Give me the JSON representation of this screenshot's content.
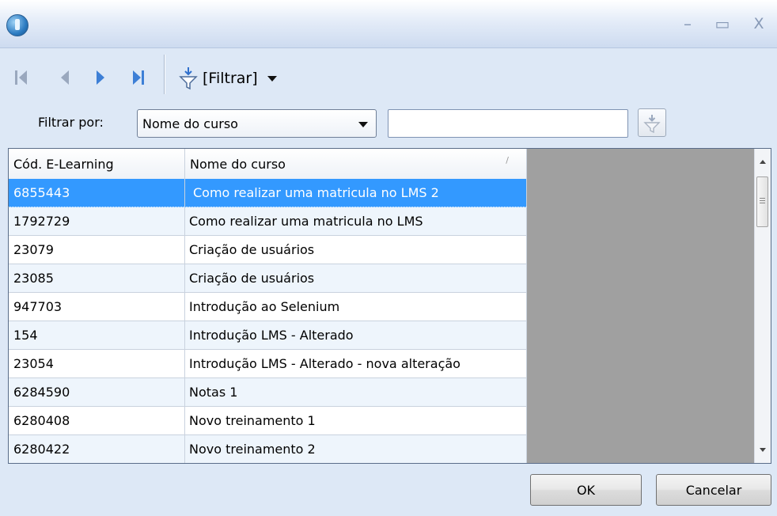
{
  "window": {
    "controls": {
      "minimize": "–",
      "maximize": "▭",
      "close": "X"
    }
  },
  "toolbar": {
    "filter_label": "[Filtrar]"
  },
  "filter_row": {
    "label": "Filtrar por:",
    "selected_field": "Nome do curso",
    "search_value": ""
  },
  "grid": {
    "columns": [
      "Cód. E-Learning",
      "Nome do curso"
    ],
    "sort_indicator": "/",
    "rows": [
      {
        "code": "6855443",
        "name": "Como realizar uma matricula no LMS 2"
      },
      {
        "code": "1792729",
        "name": "Como realizar uma matricula no LMS"
      },
      {
        "code": "23079",
        "name": "Criação de usuários"
      },
      {
        "code": "23085",
        "name": "Criação de usuários"
      },
      {
        "code": "947703",
        "name": "Introdução ao Selenium"
      },
      {
        "code": "154",
        "name": "Introdução LMS - Alterado"
      },
      {
        "code": "23054",
        "name": "Introdução LMS - Alterado - nova alteração"
      },
      {
        "code": "6284590",
        "name": "Notas 1"
      },
      {
        "code": "6280408",
        "name": "Novo treinamento 1"
      },
      {
        "code": "6280422",
        "name": "Novo treinamento 2"
      }
    ],
    "selected_row_index": 0
  },
  "buttons": {
    "ok": "OK",
    "cancel": "Cancelar"
  },
  "colors": {
    "selection": "#3399ff",
    "background": "#dde8f6",
    "gray_area": "#a0a0a0"
  }
}
